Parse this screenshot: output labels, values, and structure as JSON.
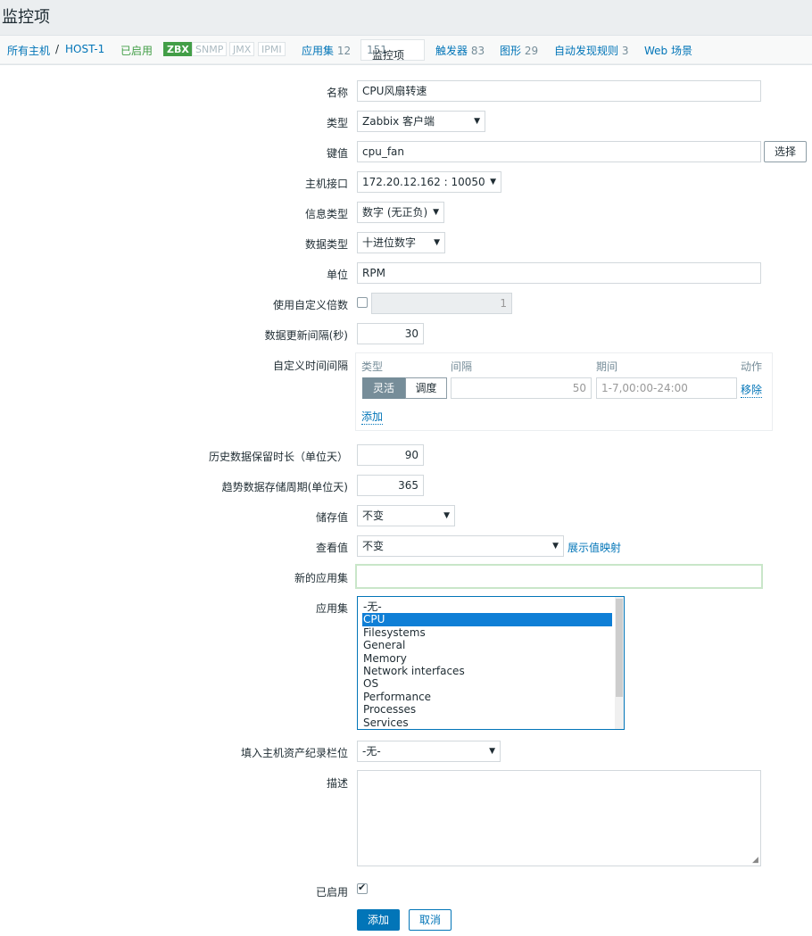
{
  "page": {
    "title": "监控项"
  },
  "nav": {
    "all_hosts": "所有主机",
    "separator": "/",
    "host": "HOST-1",
    "status": "已启用",
    "badges": [
      "ZBX",
      "SNMP",
      "JMX",
      "IPMI"
    ],
    "applications": {
      "label": "应用集",
      "count": "12"
    },
    "items": {
      "label": "监控项",
      "count": "151"
    },
    "triggers": {
      "label": "触发器",
      "count": "83"
    },
    "graphs": {
      "label": "图形",
      "count": "29"
    },
    "discovery": {
      "label": "自动发现规则",
      "count": "3"
    },
    "web": {
      "label": "Web 场景"
    }
  },
  "form": {
    "name": {
      "label": "名称",
      "value": "CPU风扇转速"
    },
    "type": {
      "label": "类型",
      "value": "Zabbix 客户端"
    },
    "key": {
      "label": "键值",
      "value": "cpu_fan",
      "select_label": "选择"
    },
    "host_interface": {
      "label": "主机接口",
      "value": "172.20.12.162 : 10050"
    },
    "info_type": {
      "label": "信息类型",
      "value": "数字 (无正负)"
    },
    "data_type": {
      "label": "数据类型",
      "value": "十进位数字"
    },
    "units": {
      "label": "单位",
      "value": "RPM"
    },
    "multiplier": {
      "label": "使用自定义倍数",
      "value": "1",
      "checked": false
    },
    "update_interval": {
      "label": "数据更新间隔(秒)",
      "value": "30"
    },
    "custom_intervals": {
      "label": "自定义时间间隔",
      "headers": {
        "type": "类型",
        "interval": "间隔",
        "period": "期间",
        "action": "动作"
      },
      "type_flexible": "灵活",
      "type_scheduling": "调度",
      "interval_value": "50",
      "period_value": "1-7,00:00-24:00",
      "remove_label": "移除",
      "add_label": "添加"
    },
    "history": {
      "label": "历史数据保留时长（单位天）",
      "value": "90"
    },
    "trends": {
      "label": "趋势数据存储周期(单位天)",
      "value": "365"
    },
    "store_value": {
      "label": "储存值",
      "value": "不变"
    },
    "show_value": {
      "label": "查看值",
      "value": "不变",
      "mapping_link": "展示值映射"
    },
    "new_application": {
      "label": "新的应用集",
      "value": ""
    },
    "applications": {
      "label": "应用集",
      "options": [
        "-无-",
        "CPU",
        "Filesystems",
        "General",
        "Memory",
        "Network interfaces",
        "OS",
        "Performance",
        "Processes",
        "Services"
      ],
      "selected": "CPU"
    },
    "inventory": {
      "label": "填入主机资产纪录栏位",
      "value": "-无-"
    },
    "description": {
      "label": "描述",
      "value": ""
    },
    "enabled": {
      "label": "已启用",
      "checked": true
    },
    "add_button": "添加",
    "cancel_button": "取消"
  },
  "colors": {
    "link": "#0275b8",
    "enabled": "#429e47",
    "button": "#0275b8"
  }
}
